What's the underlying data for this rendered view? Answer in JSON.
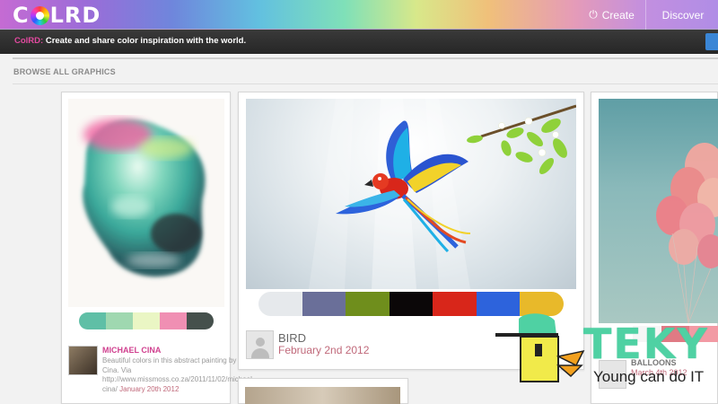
{
  "header": {
    "logo_c": "C",
    "logo_rest": "LRD",
    "create_icon": "power-icon",
    "create_label": "Create",
    "discover_label": "Discover"
  },
  "tagline": {
    "brand": "ColRD:",
    "text": " Create and share color inspiration with the world."
  },
  "section": {
    "title": "BROWSE ALL GRAPHICS"
  },
  "cards": [
    {
      "author": "MICHAEL CINA",
      "description": "Beautiful colors in this abstract painting by Michael Cina. Via http://www.missmoss.co.za/2011/11/02/michael-cina/ ",
      "date": "January 20th 2012",
      "palette": [
        "#5fbfa6",
        "#9fd8b0",
        "#eaf6c4",
        "#f08fb3",
        "#45504c"
      ]
    },
    {
      "title": "BIRD",
      "date": "February 2nd 2012",
      "palette": [
        "#e6e9ec",
        "#6a6f99",
        "#6f8e1c",
        "#0b0708",
        "#d8261a",
        "#2d63dc",
        "#e8b92a"
      ]
    },
    {
      "title": "BALLOONS",
      "date": "March 4th 2012",
      "palette": [
        "#f6f6f6",
        "#e07a84",
        "#f29aa4"
      ]
    }
  ],
  "watermark": {
    "brand": "TEKY",
    "slogan": "Young can do IT"
  },
  "colors": {
    "brand_pink": "#d0418f",
    "date_rose": "#c0697a",
    "teky_green": "#4fd1a3"
  }
}
